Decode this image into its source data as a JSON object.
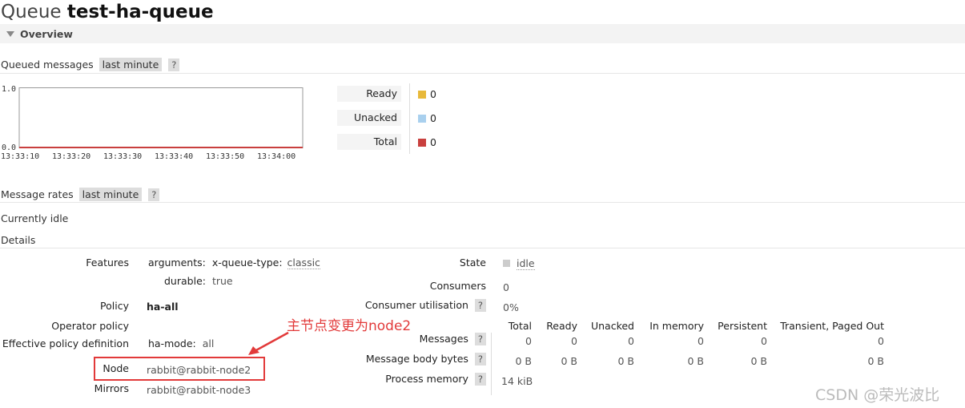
{
  "header": {
    "title_prefix": "Queue",
    "queue_name": "test-ha-queue"
  },
  "overview": {
    "label": "Overview"
  },
  "queued_messages": {
    "label": "Queued messages",
    "range": "last minute",
    "help": "?",
    "chart_data": {
      "type": "line",
      "x": [
        "13:33:10",
        "13:33:20",
        "13:33:30",
        "13:33:40",
        "13:33:50",
        "13:34:00"
      ],
      "ylim": [
        0.0,
        1.0
      ],
      "y_ticks": [
        "1.0",
        "0.0"
      ],
      "series": [
        {
          "name": "Ready",
          "color": "#e8b93a",
          "values": [
            0,
            0,
            0,
            0,
            0,
            0
          ]
        },
        {
          "name": "Unacked",
          "color": "#a9d0ee",
          "values": [
            0,
            0,
            0,
            0,
            0,
            0
          ]
        },
        {
          "name": "Total",
          "color": "#c9403e",
          "values": [
            0,
            0,
            0,
            0,
            0,
            0
          ]
        }
      ]
    },
    "legend": [
      {
        "label": "Ready",
        "value": "0",
        "color": "#e8b93a"
      },
      {
        "label": "Unacked",
        "value": "0",
        "color": "#a9d0ee"
      },
      {
        "label": "Total",
        "value": "0",
        "color": "#c9403e"
      }
    ]
  },
  "message_rates": {
    "label": "Message rates",
    "range": "last minute",
    "help": "?",
    "status": "Currently idle"
  },
  "details": {
    "label": "Details",
    "features_label": "Features",
    "arguments_key": "arguments:",
    "x_queue_type_key": "x-queue-type:",
    "x_queue_type_val": "classic",
    "durable_key": "durable:",
    "durable_val": "true",
    "policy_label": "Policy",
    "policy_val": "ha-all",
    "operator_policy_label": "Operator policy",
    "effective_label": "Effective policy definition",
    "ha_mode_key": "ha-mode:",
    "ha_mode_val": "all",
    "node_label": "Node",
    "node_val": "rabbit@rabbit-node2",
    "mirrors_label": "Mirrors",
    "mirrors_val": "rabbit@rabbit-node3",
    "state_label": "State",
    "state_val": "idle",
    "consumers_label": "Consumers",
    "consumers_val": "0",
    "consumer_util_label": "Consumer utilisation",
    "consumer_util_val": "0%",
    "help": "?",
    "columns": [
      "Total",
      "Ready",
      "Unacked",
      "In memory",
      "Persistent",
      "Transient, Paged Out"
    ],
    "messages_label": "Messages",
    "messages_vals": [
      "0",
      "0",
      "0",
      "0",
      "0",
      "0"
    ],
    "body_bytes_label": "Message body bytes",
    "body_bytes_vals": [
      "0 B",
      "0 B",
      "0 B",
      "0 B",
      "0 B",
      "0 B"
    ],
    "process_memory_label": "Process memory",
    "process_memory_val": "14 kiB"
  },
  "annotation": {
    "text": "主节点变更为node2",
    "color": "#e23a3a"
  },
  "watermark": "CSDN @荣光波比"
}
